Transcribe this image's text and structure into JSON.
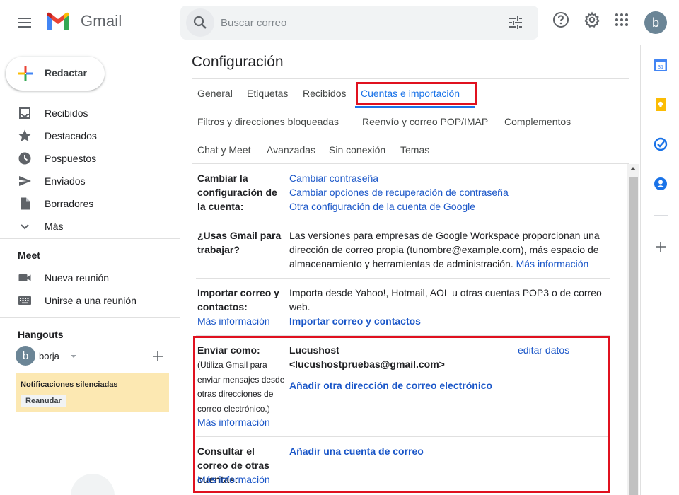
{
  "header": {
    "app_name": "Gmail",
    "search_placeholder": "Buscar correo",
    "avatar_letter": "b"
  },
  "sidebar": {
    "compose_label": "Redactar",
    "items": [
      {
        "label": "Recibidos",
        "icon": "inbox-icon"
      },
      {
        "label": "Destacados",
        "icon": "star-icon"
      },
      {
        "label": "Pospuestos",
        "icon": "clock-icon"
      },
      {
        "label": "Enviados",
        "icon": "send-icon"
      },
      {
        "label": "Borradores",
        "icon": "draft-icon"
      },
      {
        "label": "Más",
        "icon": "chevron-down-icon"
      }
    ],
    "meet": {
      "title": "Meet",
      "items": [
        {
          "label": "Nueva reunión",
          "icon": "video-icon"
        },
        {
          "label": "Unirse a una reunión",
          "icon": "keyboard-icon"
        }
      ]
    },
    "hangouts": {
      "title": "Hangouts",
      "user_letter": "b",
      "user_name": "borja",
      "notification": "Notificaciones silenciadas",
      "resume_label": "Reanudar"
    }
  },
  "settings": {
    "title": "Configuración",
    "tabs": [
      {
        "label": "General"
      },
      {
        "label": "Etiquetas"
      },
      {
        "label": "Recibidos"
      },
      {
        "label": "Cuentas e importación",
        "active": true
      },
      {
        "label": "Filtros y direcciones bloqueadas"
      },
      {
        "label": "Reenvío y correo POP/IMAP"
      },
      {
        "label": "Complementos"
      },
      {
        "label": "Chat y Meet"
      },
      {
        "label": "Avanzadas"
      },
      {
        "label": "Sin conexión"
      },
      {
        "label": "Temas"
      }
    ],
    "rows": {
      "account": {
        "label": "Cambiar la configuración de la cuenta:",
        "links": [
          "Cambiar contraseña",
          "Cambiar opciones de recuperación de contraseña",
          "Otra configuración de la cuenta de Google"
        ]
      },
      "workspace": {
        "label": "¿Usas Gmail para trabajar?",
        "text": "Las versiones para empresas de Google Workspace proporcionan una dirección de correo propia (tunombre@example.com), más espacio de almacenamiento y herramientas de administración.",
        "link": "Más información"
      },
      "import": {
        "label": "Importar correo y contactos:",
        "more_info": "Más información",
        "text": "Importa desde Yahoo!, Hotmail, AOL u otras cuentas POP3 o de correo web.",
        "action": "Importar correo y contactos"
      },
      "send_as": {
        "label": "Enviar como:",
        "sub": "(Utiliza Gmail para enviar mensajes desde otras direcciones de correo electrónico.)",
        "more_info": "Más información",
        "name": "Lucushost",
        "email": "<lucushostpruebas@gmail.com>",
        "edit": "editar datos",
        "add": "Añadir otra dirección de correo electrónico"
      },
      "check_mail": {
        "label": "Consultar el correo de otras cuentas:",
        "more_info": "Más información",
        "add": "Añadir una cuenta de correo"
      }
    }
  },
  "right_panel": {
    "icons": [
      "calendar-icon",
      "keep-icon",
      "tasks-icon",
      "contacts-icon",
      "add-icon"
    ],
    "calendar_day": "31"
  },
  "colors": {
    "accent": "#1a73e8",
    "link": "#1a56c8",
    "highlight": "#e0111f",
    "notification_bg": "#fce8b2"
  }
}
